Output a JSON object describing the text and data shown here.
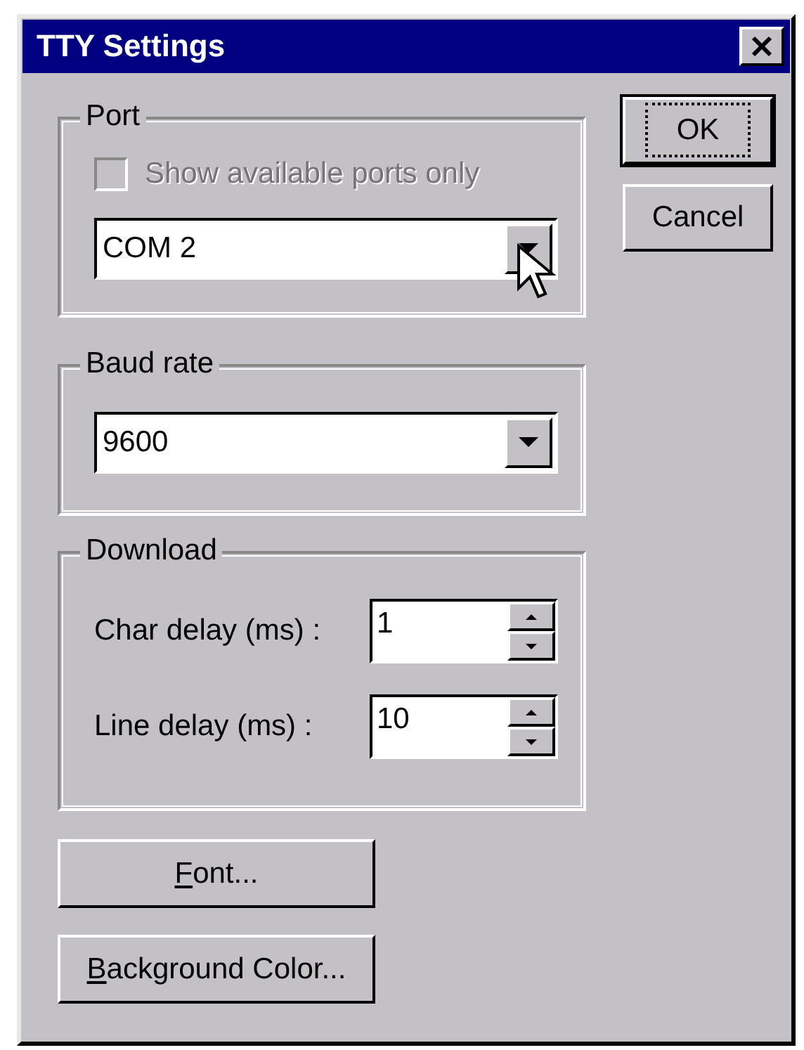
{
  "window": {
    "title": "TTY Settings"
  },
  "port": {
    "title": "Port",
    "available_only": {
      "label": "Show available ports only",
      "checked": false,
      "disabled": true
    },
    "value": "COM 2"
  },
  "baud_rate": {
    "title": "Baud rate",
    "value": "9600"
  },
  "download": {
    "title": "Download",
    "fields": [
      {
        "label": "Char delay (ms) :",
        "value": "1"
      },
      {
        "label": "Line delay (ms) :",
        "value": "10"
      }
    ]
  },
  "dialog_buttons": [
    {
      "label": "OK",
      "default": true
    },
    {
      "label": "Cancel",
      "default": false
    }
  ],
  "buttons": [
    {
      "accel": "F",
      "rest": "ont..."
    },
    {
      "accel": "B",
      "rest": "ackground Color..."
    }
  ]
}
